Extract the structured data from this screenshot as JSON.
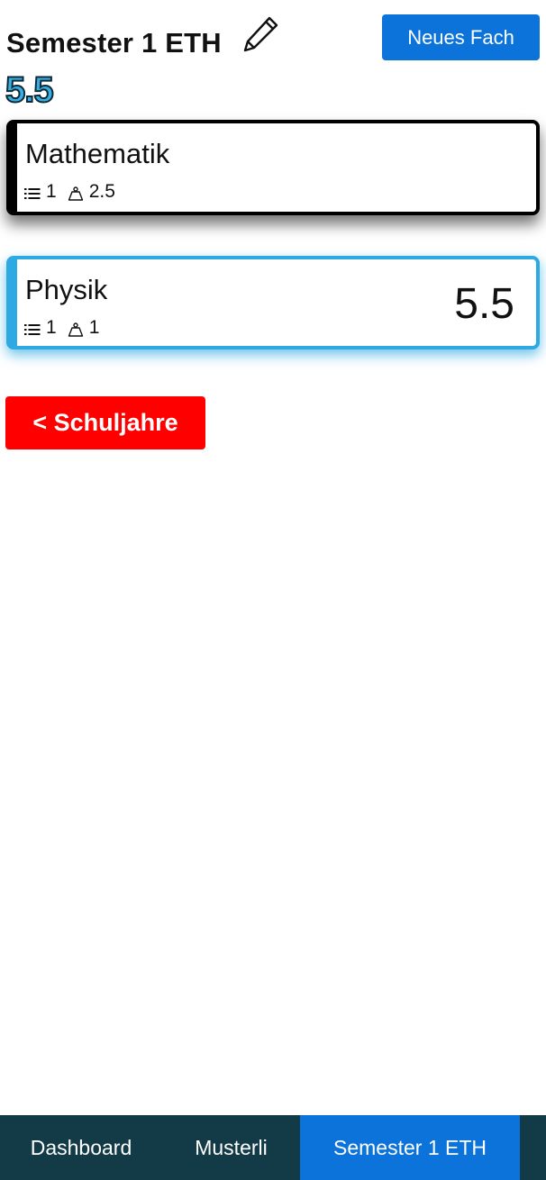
{
  "header": {
    "title": "Semester 1 ETH",
    "new_subject_label": "Neues Fach"
  },
  "average": "5.5",
  "subjects": [
    {
      "name": "Mathematik",
      "entries_count": "1",
      "weight": "2.5",
      "grade": ""
    },
    {
      "name": "Physik",
      "entries_count": "1",
      "weight": "1",
      "grade": "5.5"
    }
  ],
  "back_button_label": "< Schuljahre",
  "nav": {
    "tabs": [
      {
        "label": "Dashboard"
      },
      {
        "label": "Musterli"
      },
      {
        "label": "Semester 1 ETH",
        "active": true
      }
    ]
  },
  "colors": {
    "primary": "#0b73d9",
    "danger": "#ff0000",
    "nav_bg": "#123a47",
    "physik_accent": "#2fa9e2",
    "grade_accent": "#3aaee0"
  },
  "icons": {
    "edit": "pencil-icon",
    "entries": "list-icon",
    "weight": "weight-icon"
  }
}
